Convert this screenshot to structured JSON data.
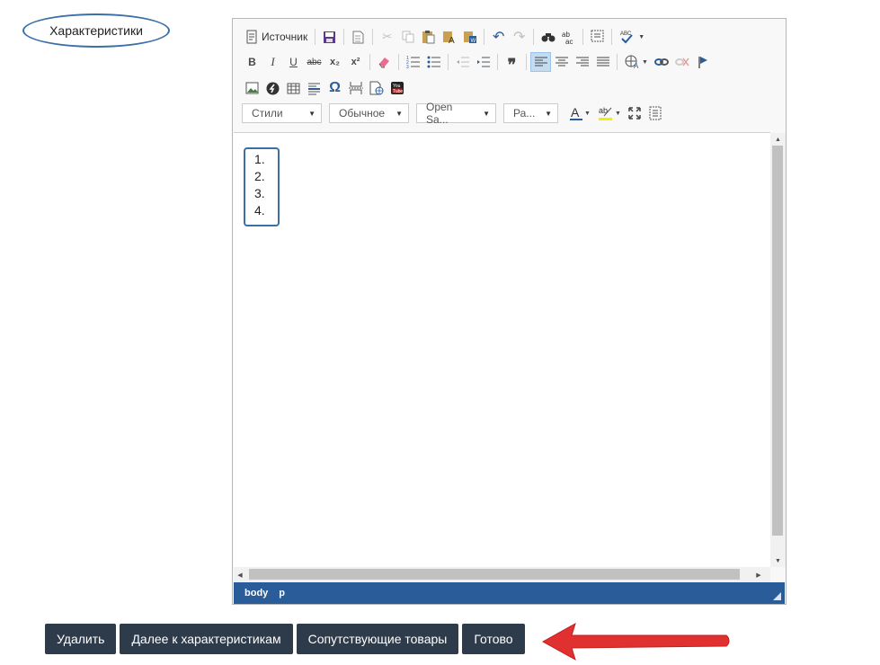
{
  "section": {
    "label": "Характеристики"
  },
  "toolbar": {
    "source_label": "Источник",
    "combos": {
      "styles": "Стили",
      "format": "Обычное",
      "font": "Open Sa...",
      "size": "Ра..."
    },
    "icons": {
      "source": "source-icon",
      "save": "save-icon",
      "new_page": "new-page-icon",
      "cut": "cut-icon",
      "copy": "copy-icon",
      "paste": "paste-icon",
      "paste_text": "paste-text-icon",
      "paste_word": "paste-word-icon",
      "undo": "undo-icon",
      "redo": "redo-icon",
      "find": "find-icon",
      "replace": "replace-icon",
      "select_all": "select-all-icon",
      "spellcheck": "spellcheck-icon",
      "bold": "B",
      "italic": "I",
      "underline": "U",
      "strike": "abc",
      "subscript": "x₂",
      "superscript": "x²",
      "omega": "Ω"
    }
  },
  "editor": {
    "list_items": [
      "1.",
      "2.",
      "3.",
      "4."
    ],
    "path": [
      "body",
      "p"
    ]
  },
  "colors": {
    "accent": "#2a5c9a",
    "button": "#2e3b4a",
    "annotation": "#e03030",
    "outline": "#3a6fa8"
  },
  "buttons": {
    "delete": "Удалить",
    "next": "Далее к характеристикам",
    "related": "Сопутствующие товары",
    "done": "Готово"
  }
}
